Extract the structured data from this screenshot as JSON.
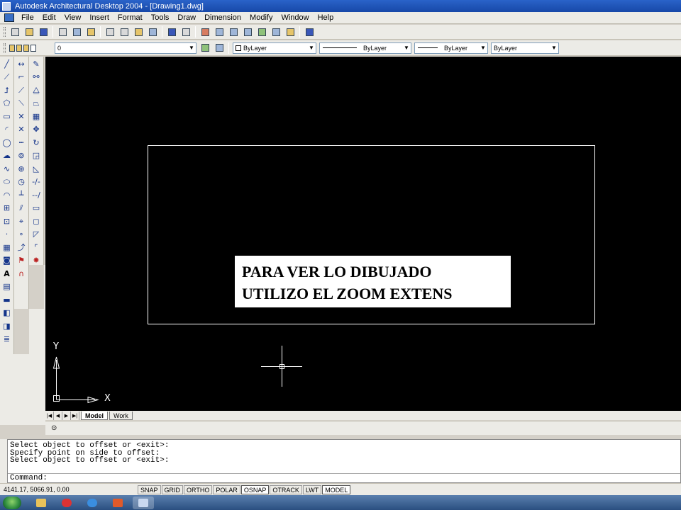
{
  "window": {
    "title": "Autodesk Architectural Desktop 2004 - [Drawing1.dwg]"
  },
  "menu": [
    "File",
    "Edit",
    "View",
    "Insert",
    "Format",
    "Tools",
    "Draw",
    "Dimension",
    "Modify",
    "Window",
    "Help"
  ],
  "layer_combo": {
    "value": "0"
  },
  "properties": {
    "color": "ByLayer",
    "linetype": "ByLayer",
    "lineweight": "ByLayer",
    "plotstyle": "ByLayer"
  },
  "canvas": {
    "annotation_line1": "PARA VER LO DIBUJADO",
    "annotation_line2": "UTILIZO EL ZOOM EXTENS",
    "ucs_x": "X",
    "ucs_y": "Y",
    "background_color": "#000000",
    "line_color": "#ffffff"
  },
  "layout_tabs": [
    "Model",
    "Work"
  ],
  "command_history": [
    "Select object to offset or <exit>:",
    "Specify point on side to offset:",
    "Select object to offset or <exit>:"
  ],
  "command_prompt": "Command:",
  "status": {
    "coords": "4141.17, 5066.91, 0.00",
    "toggles": [
      "SNAP",
      "GRID",
      "ORTHO",
      "POLAR",
      "OSNAP",
      "OTRACK",
      "LWT",
      "MODEL"
    ],
    "active": [
      "OSNAP",
      "MODEL"
    ]
  },
  "icons": {
    "draw": [
      "line-icon",
      "construction-line-icon",
      "polyline-icon",
      "polygon-icon",
      "rectangle-icon",
      "arc-icon",
      "circle-icon",
      "revision-cloud-icon",
      "spline-icon",
      "ellipse-icon",
      "ellipse-arc-icon",
      "insert-block-icon",
      "make-block-icon",
      "point-icon",
      "hatch-icon",
      "region-icon",
      "multiline-text-icon"
    ],
    "taskbar": [
      "explorer-icon",
      "media-player-icon",
      "internet-explorer-icon",
      "office-icon",
      "autocad-icon"
    ]
  }
}
